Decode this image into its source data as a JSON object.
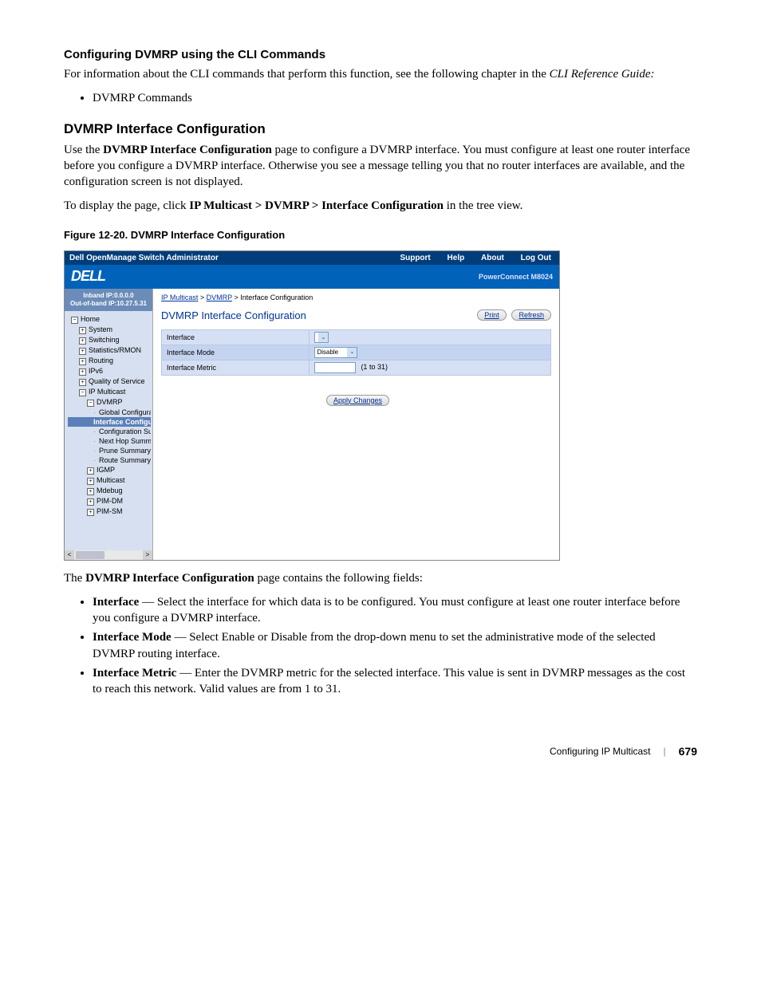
{
  "sec1": {
    "heading": "Configuring DVMRP using the CLI Commands",
    "para": "For information about the CLI commands that perform this function, see the following chapter in the ",
    "ref": "CLI Reference Guide:",
    "bullet": "DVMRP Commands"
  },
  "sec2": {
    "heading": "DVMRP Interface Configuration",
    "p1a": "Use the ",
    "p1b": "DVMRP Interface Configuration",
    "p1c": " page to configure a DVMRP interface. You must configure at least one router interface before you configure a DVMRP interface. Otherwise you see a message telling you that no router interfaces are available, and the configuration screen is not displayed.",
    "p2a": "To display the page, click ",
    "p2b": "IP Multicast > DVMRP > Interface Configuration",
    "p2c": " in the tree view."
  },
  "fig": {
    "caption": "Figure 12-20.    DVMRP Interface Configuration"
  },
  "ss": {
    "top_title": "Dell OpenManage Switch Administrator",
    "links": {
      "support": "Support",
      "help": "Help",
      "about": "About",
      "logout": "Log Out"
    },
    "brand": "DELL",
    "model": "PowerConnect M8024",
    "ip1": "Inband IP:0.0.0.0",
    "ip2": "Out-of-band IP:10.27.5.31",
    "tree": {
      "home": "Home",
      "system": "System",
      "switching": "Switching",
      "stats": "Statistics/RMON",
      "routing": "Routing",
      "ipv6": "IPv6",
      "qos": "Quality of Service",
      "ipm": "IP Multicast",
      "dvmrp": "DVMRP",
      "gc": "Global Configuration",
      "ic": "Interface Configurat",
      "cs": "Configuration Summa",
      "nhs": "Next Hop Summary",
      "ps": "Prune Summary",
      "rs": "Route Summary",
      "igmp": "IGMP",
      "multicast": "Multicast",
      "mdebug": "Mdebug",
      "pimdm": "PIM-DM",
      "pimsm": "PIM-SM"
    },
    "crumb": {
      "a": "IP Multicast",
      "b": "DVMRP",
      "c": "Interface Configuration",
      "sep": " > "
    },
    "main_title": "DVMRP Interface Configuration",
    "btn_print": "Print",
    "btn_refresh": "Refresh",
    "rows": {
      "r1": "Interface",
      "r2": "Interface Mode",
      "r2v": "Disable",
      "r3": "Interface Metric",
      "r3hint": "(1 to 31)"
    },
    "apply": "Apply Changes"
  },
  "sec3": {
    "lead_a": "The ",
    "lead_b": "DVMRP Interface Configuration",
    "lead_c": " page contains the following fields:",
    "b1a": "Interface",
    "b1b": " — Select the interface for which data is to be configured. You must configure at least one router interface before you configure a DVMRP interface.",
    "b2a": "Interface Mode",
    "b2b": " — Select Enable or Disable from the drop-down menu to set the administrative mode of the selected DVMRP routing interface.",
    "b3a": "Interface Metric",
    "b3b": " — Enter the DVMRP metric for the selected interface. This value is sent in DVMRP messages as the cost to reach this network. Valid values are from 1 to 31."
  },
  "foot": {
    "section": "Configuring IP Multicast",
    "page": "679"
  }
}
